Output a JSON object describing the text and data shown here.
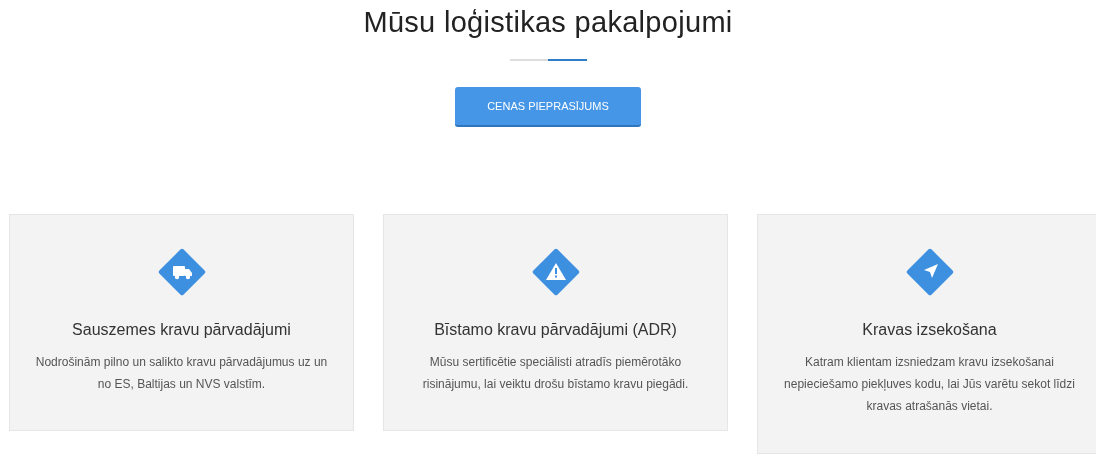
{
  "heading": "Mūsu loģistikas pakalpojumi",
  "button": {
    "label": "CENAS PIEPRASĪJUMS"
  },
  "services": [
    {
      "kind": "truck",
      "title": "Sauszemes kravu pārvadājumi",
      "text": "Nodrošinām pilno un salikto kravu pārvadājumus uz un no ES, Baltijas un NVS valstīm."
    },
    {
      "kind": "warning",
      "title": "Bīstamo kravu pārvadājumi (ADR)",
      "text": "Mūsu sertificētie speciālisti atradīs piemērotāko risinājumu, lai veiktu drošu bīstamo kravu piegādi."
    },
    {
      "kind": "navigation",
      "title": "Kravas izsekošana",
      "text": "Katram klientam izsniedzam kravu izsekošanai nepieciešamo piekļuves kodu, lai Jūs varētu sekot līdzi kravas atrašanās vietai."
    }
  ]
}
